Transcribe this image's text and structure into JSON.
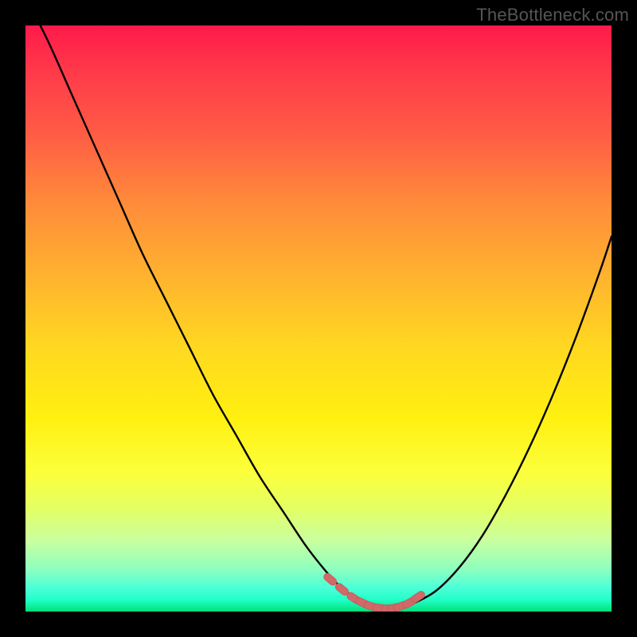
{
  "attribution": "TheBottleneck.com",
  "colors": {
    "page_bg": "#000000",
    "gradient_top": "#ff1a4a",
    "gradient_mid": "#ffd820",
    "gradient_bottom": "#00e078",
    "curve_stroke": "#000000",
    "marker_fill": "#d06a6a",
    "marker_stroke": "#c85a5a"
  },
  "chart_data": {
    "type": "line",
    "title": "",
    "xlabel": "",
    "ylabel": "",
    "xlim": [
      0,
      100
    ],
    "ylim": [
      0,
      100
    ],
    "x": [
      0,
      4,
      8,
      12,
      16,
      20,
      24,
      28,
      32,
      36,
      40,
      44,
      48,
      52,
      54,
      56,
      58,
      60,
      62,
      64,
      66,
      70,
      74,
      78,
      82,
      86,
      90,
      94,
      98,
      100
    ],
    "values": [
      105,
      97,
      88,
      79,
      70,
      61,
      53,
      45,
      37,
      30,
      23,
      17,
      11,
      6,
      4,
      2.5,
      1.5,
      0.8,
      0.5,
      0.7,
      1.3,
      3.5,
      7.5,
      13,
      20,
      28,
      37,
      47,
      58,
      64
    ],
    "markers": {
      "x": [
        52,
        54,
        56,
        57.5,
        59,
        60.5,
        62,
        63,
        64,
        65.5,
        67
      ],
      "y": [
        5.5,
        3.8,
        2.3,
        1.5,
        0.9,
        0.6,
        0.5,
        0.65,
        0.9,
        1.5,
        2.5
      ]
    },
    "grid": false,
    "legend": false
  }
}
